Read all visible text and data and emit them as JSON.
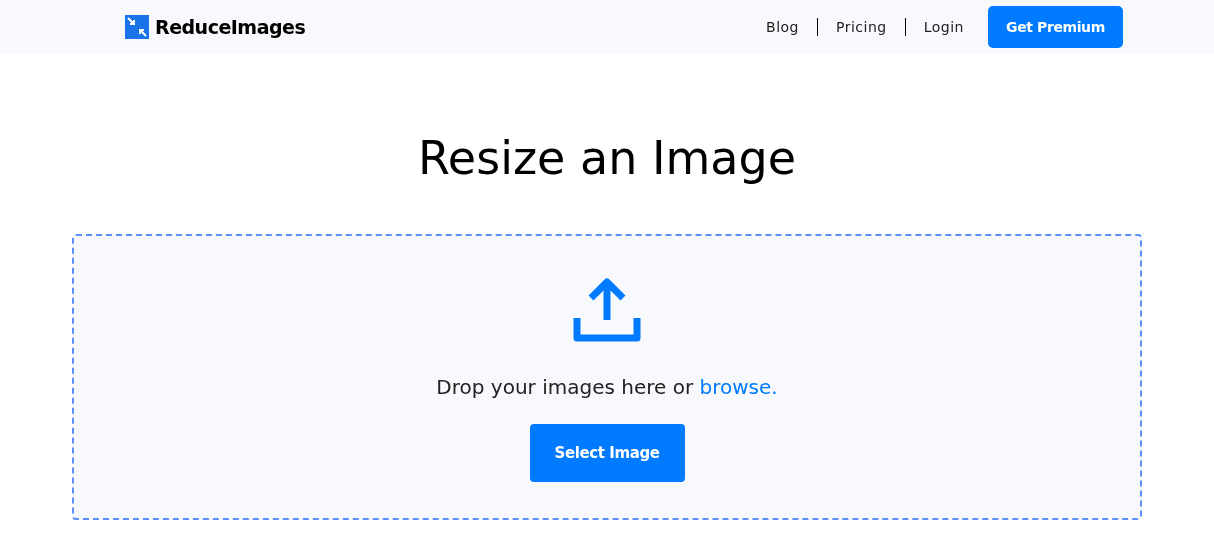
{
  "header": {
    "logo": "ReduceImages",
    "nav": [
      "Blog",
      "Pricing",
      "Login"
    ],
    "cta": "Get Premium"
  },
  "title": "Resize an Image",
  "dropzone": {
    "text": "Drop your images here or ",
    "link": "browse.",
    "button": "Select Image"
  }
}
